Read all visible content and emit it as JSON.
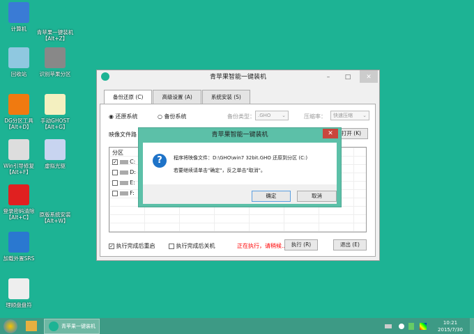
{
  "desktop": {
    "icons": [
      {
        "label": "计算机",
        "icon": "computer-icon",
        "color": "#3a7bd5"
      },
      {
        "label": "青苹果一键装机【Alt+Z】",
        "icon": "ghost-icon",
        "color": "#1db394"
      },
      {
        "label": "回收站",
        "icon": "recycle-bin-icon",
        "color": "#8fc8e0"
      },
      {
        "label": "识别苹果分区",
        "icon": "hard-drive-icon",
        "color": "#888888"
      },
      {
        "label": "DG分区工具【Alt+D】",
        "icon": "diskgenius-icon",
        "color": "#f07a10"
      },
      {
        "label": "手动GHOST【Alt+G】",
        "icon": "ghost-icon",
        "color": "#f4f0c0"
      },
      {
        "label": "Win引导修复【Alt+F】",
        "icon": "toolbox-icon",
        "color": "#dddddd"
      },
      {
        "label": "虚拟光驱",
        "icon": "virtual-drive-icon",
        "color": "#c8d4f0"
      },
      {
        "label": "登录密码清除【Alt+C】",
        "icon": "nt-key-icon",
        "color": "#e02020"
      },
      {
        "label": "原版系统安装【Alt+W】",
        "icon": "ghost-icon",
        "color": "#1db394"
      },
      {
        "label": "加载外置SRS",
        "icon": "firewire-icon",
        "color": "#2a78d0"
      },
      {
        "label": "理顺盘盘符",
        "icon": "drive-swap-icon",
        "color": "#eeeeee"
      }
    ]
  },
  "window": {
    "title": "青苹果智能一键装机",
    "tabs": [
      "备份还原 (C)",
      "高级设置 (A)",
      "系统安装 (S)"
    ],
    "restore_label": "还原系统",
    "backup_label": "备份系统",
    "backup_type_label": "备份类型：",
    "backup_type_value": ".GHO",
    "compression_label": "压缩率：",
    "compression_value": "快速压缩",
    "image_path_label": "映像文件路",
    "open_button": "打开 (K)",
    "partition_header": "分区",
    "partitions": [
      {
        "label": "C:",
        "checked": true
      },
      {
        "label": "D:",
        "checked": false
      },
      {
        "label": "E:",
        "checked": false
      },
      {
        "label": "F:",
        "checked": false
      }
    ],
    "reboot_label": "执行完成后重启",
    "shutdown_label": "执行完成后关机",
    "status": "正在执行，请稍候...",
    "status_color": "#ff0000",
    "execute_button": "执行 (R)",
    "exit_button": "退出 (E)"
  },
  "dialog": {
    "title": "青苹果智能一键装机",
    "line1": "程序将映像文件：D:\\GHO\\win7 32bit.GHO 还原到分区 (C:)",
    "line2": "若要继续请单击\"确定\"，反之单击\"取消\"。",
    "ok": "确定",
    "cancel": "取消"
  },
  "taskbar": {
    "app_label": "青苹果一键装机",
    "time": "10:21",
    "date": "2015/7/30"
  }
}
